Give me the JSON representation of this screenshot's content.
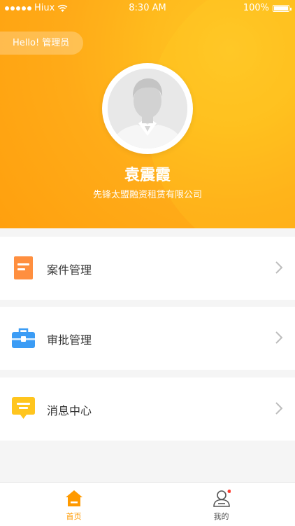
{
  "status_bar": {
    "carrier": "Hiux",
    "time": "8:30 AM",
    "battery": "100%"
  },
  "profile": {
    "greeting": "Hello! 管理员",
    "name": "袁震霞",
    "company": "先锋太盟融资租赁有限公司"
  },
  "menu": {
    "items": [
      {
        "label": "案件管理",
        "icon": "document-icon",
        "color": "#ff8f3f"
      },
      {
        "label": "审批管理",
        "icon": "briefcase-icon",
        "color": "#3b9cf5"
      },
      {
        "label": "消息中心",
        "icon": "message-icon",
        "color": "#ffc51e"
      }
    ]
  },
  "tabbar": {
    "tabs": [
      {
        "label": "首页",
        "icon": "home-icon",
        "active": true
      },
      {
        "label": "我的",
        "icon": "user-icon",
        "active": false,
        "badge": true
      }
    ]
  },
  "colors": {
    "accent": "#ffa10a",
    "tab_active": "#ff9a00",
    "tab_inactive": "#555555",
    "badge": "#ff3b30"
  }
}
